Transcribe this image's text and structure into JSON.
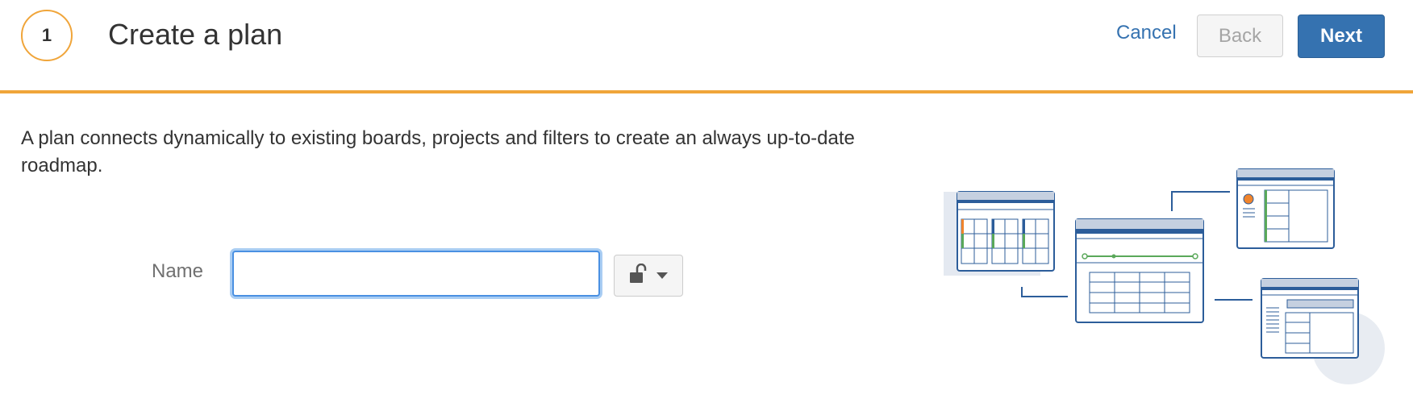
{
  "header": {
    "step_number": "1",
    "title": "Create a plan",
    "cancel_label": "Cancel",
    "back_label": "Back",
    "next_label": "Next"
  },
  "main": {
    "description": "A plan connects dynamically to existing boards, projects and filters to create an always up-to-date roadmap.",
    "name_label": "Name",
    "name_value": "",
    "name_placeholder": "",
    "privacy_icon": "unlock-icon",
    "dropdown_icon": "caret-down-icon"
  },
  "colors": {
    "accent": "#f0a53a",
    "primary": "#3572b0",
    "illustration_blue": "#2c5d9a",
    "illustration_orange": "#f0842c",
    "illustration_green": "#5aa85a"
  }
}
